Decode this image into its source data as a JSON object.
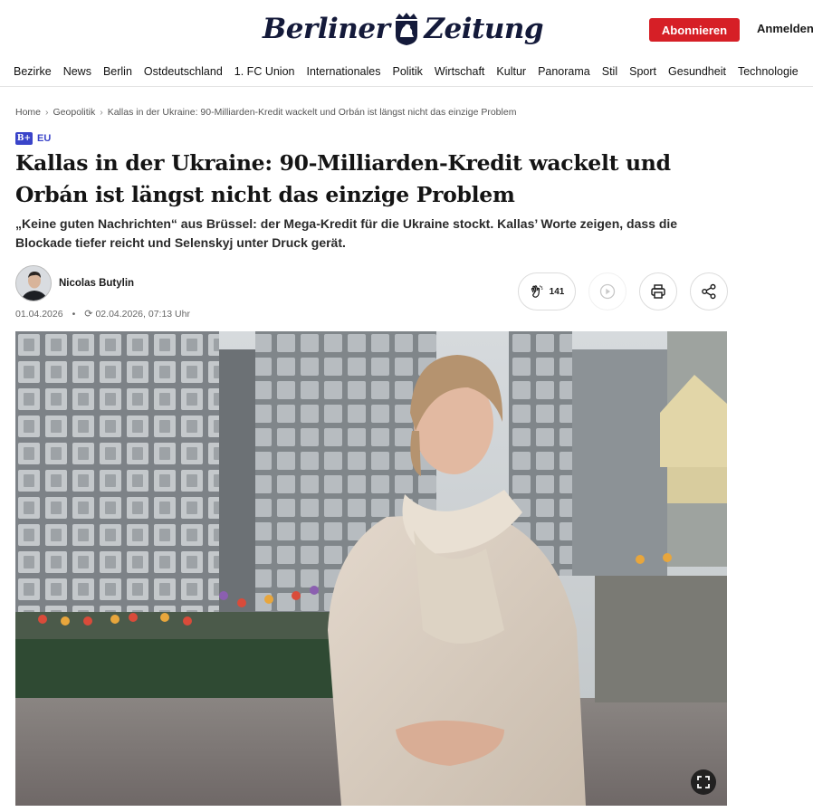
{
  "header": {
    "logo_text": "Berliner Zeitung",
    "subscribe_label": "Abonnieren",
    "login_label": "Anmelden"
  },
  "nav": {
    "items": [
      "Bezirke",
      "News",
      "Berlin",
      "Ostdeutschland",
      "1. FC Union",
      "Internationales",
      "Politik",
      "Wirtschaft",
      "Kultur",
      "Panorama",
      "Stil",
      "Sport",
      "Gesundheit",
      "Technologie"
    ]
  },
  "breadcrumb": {
    "items": [
      "Home",
      "Geopolitik",
      "Kallas in der Ukraine: 90-Milliarden-Kredit wackelt und Orbán ist längst nicht das einzige Problem"
    ]
  },
  "article": {
    "tag_icon": "B+",
    "tag": "EU",
    "headline": "Kallas in der Ukraine: 90-Milliarden-Kredit wackelt und Orbán ist längst nicht das einzige Problem",
    "lead": "„Keine guten Nachrichten“ aus Brüssel: der Mega-Kredit für die Ukraine stockt. Kallas’ Worte zeigen, dass die Blockade tiefer reicht und Selenskyj unter Druck gerät.",
    "author": "Nicolas Butylin",
    "published": "01.04.2026",
    "dot": "•",
    "updated": "02.04.2026, 07:13 Uhr",
    "claps": "141"
  },
  "icons": {
    "clap": "clap-icon",
    "play": "play-icon",
    "print": "print-icon",
    "share": "share-icon",
    "fullscreen": "fullscreen-icon",
    "refresh": "refresh-icon"
  },
  "colors": {
    "brand_red": "#d61f26",
    "tag_blue": "#3a44c9",
    "logo_navy": "#141a3a"
  }
}
